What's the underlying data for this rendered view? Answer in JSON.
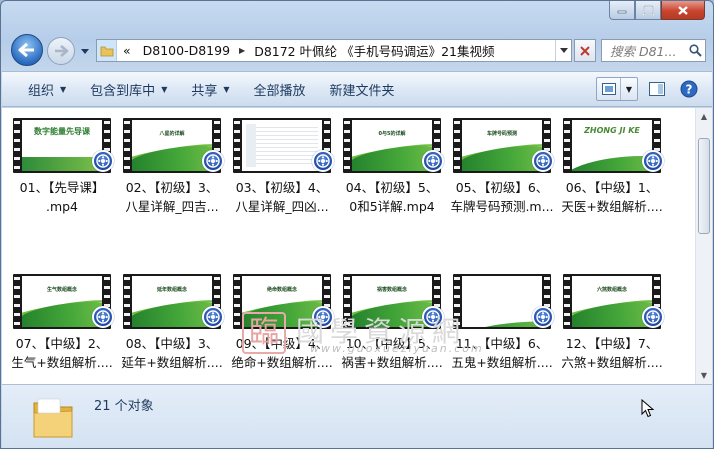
{
  "address": {
    "overflow": "«",
    "crumbs": [
      "D8100-D8199",
      "D8172 叶佩纶 《手机号码调运》21集视频"
    ]
  },
  "search": {
    "placeholder": "搜索 D81..."
  },
  "toolbar": {
    "organize": "组织",
    "include_library": "包含到库中",
    "share": "共享",
    "play_all": "全部播放",
    "new_folder": "新建文件夹"
  },
  "files": [
    {
      "line1": "01、【先导课】",
      "line2": ".mp4",
      "thumb": "intro",
      "thumb_title": "数字能量先导课"
    },
    {
      "line1": "02、【初级】3、",
      "line2": "八星详解_四吉...",
      "thumb": "green",
      "thumb_title": "八星的详解"
    },
    {
      "line1": "03、【初级】4、",
      "line2": "八星详解_四凶...",
      "thumb": "doc",
      "thumb_title": ""
    },
    {
      "line1": "04、【初级】5、",
      "line2": "0和5详解.mp4",
      "thumb": "green",
      "thumb_title": "0与5的详解"
    },
    {
      "line1": "05、【初级】6、",
      "line2": "车牌号码预测.m...",
      "thumb": "green",
      "thumb_title": "车牌号码预测"
    },
    {
      "line1": "06、【中级】1、",
      "line2": "天医+数组解析....",
      "thumb": "zhongji",
      "thumb_title": "ZHONG JI KE"
    },
    {
      "line1": "07、【中级】2、",
      "line2": "生气+数组解析....",
      "thumb": "green",
      "thumb_title": "生气数组概念"
    },
    {
      "line1": "08、【中级】3、",
      "line2": "延年+数组解析....",
      "thumb": "green",
      "thumb_title": "延年数组概念"
    },
    {
      "line1": "09、【中级】4、",
      "line2": "绝命+数组解析....",
      "thumb": "green",
      "thumb_title": "绝命数组概念"
    },
    {
      "line1": "10、【中级】5、",
      "line2": "祸害+数组解析....",
      "thumb": "green",
      "thumb_title": "祸害数组概念"
    },
    {
      "line1": "11、【中级】6、",
      "line2": "五鬼+数组解析....",
      "thumb": "plain",
      "thumb_title": ""
    },
    {
      "line1": "12、【中级】7、",
      "line2": "六煞+数组解析....",
      "thumb": "green",
      "thumb_title": "六煞数组概念"
    }
  ],
  "watermark": {
    "seal": "臨",
    "text": "國學資源網",
    "url": "www.guoxueziyuan.com"
  },
  "status": {
    "count": "21 个对象"
  }
}
